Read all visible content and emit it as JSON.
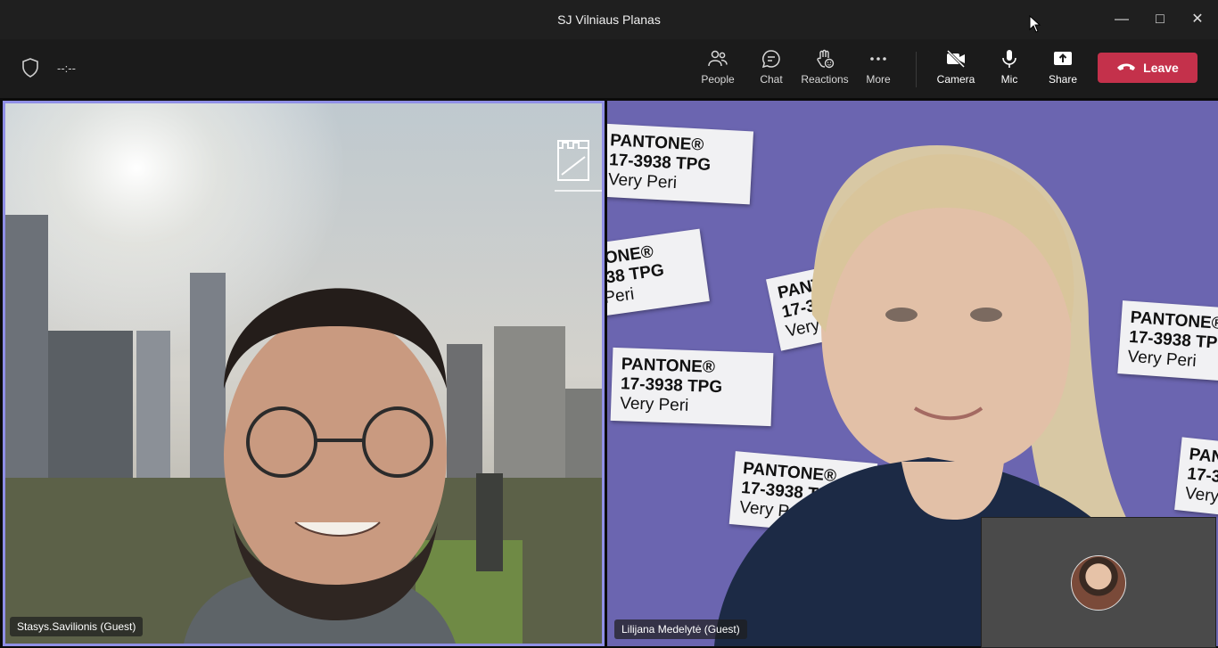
{
  "window": {
    "title": "SJ Vilniaus Planas",
    "minimize_glyph": "—",
    "maximize_glyph": "□",
    "close_glyph": "✕"
  },
  "toolbar": {
    "timer": "--:--",
    "buttons": [
      {
        "label": "People",
        "icon": "people-icon"
      },
      {
        "label": "Chat",
        "icon": "chat-icon"
      },
      {
        "label": "Reactions",
        "icon": "reactions-icon"
      },
      {
        "label": "More",
        "icon": "more-icon"
      },
      {
        "label": "Camera",
        "icon": "camera-off-icon"
      },
      {
        "label": "Mic",
        "icon": "mic-icon"
      },
      {
        "label": "Share",
        "icon": "share-icon"
      }
    ],
    "leave_label": "Leave",
    "leave_color": "#c4314b"
  },
  "participants": [
    {
      "name": "Stasys.Savilionis (Guest)",
      "active_speaker": true
    },
    {
      "name": "Lilijana Medelytė (Guest)",
      "active_speaker": false
    }
  ],
  "background_cards": {
    "brand": "PANTONE®",
    "code": "17-3938 TPG",
    "color_name": "Very Peri"
  },
  "colors": {
    "active_border": "#8f8fe6",
    "very_peri": "#6b65b0"
  }
}
